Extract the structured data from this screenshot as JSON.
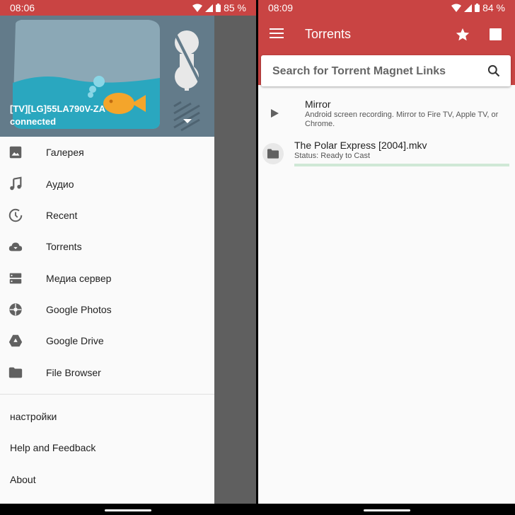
{
  "left": {
    "status_bar": {
      "time": "08:06",
      "battery": "85 %"
    },
    "device": {
      "name": "[TV][LG]55LA790V-ZA",
      "status": "connected"
    },
    "menu": [
      {
        "label": "Галерея",
        "icon": "gallery-icon"
      },
      {
        "label": "Аудио",
        "icon": "music-note-icon"
      },
      {
        "label": "Recent",
        "icon": "recent-icon"
      },
      {
        "label": "Torrents",
        "icon": "cloud-download-icon"
      },
      {
        "label": "Медиа сервер",
        "icon": "media-server-icon"
      },
      {
        "label": "Google Photos",
        "icon": "google-photos-icon"
      },
      {
        "label": "Google Drive",
        "icon": "google-drive-icon"
      },
      {
        "label": "File Browser",
        "icon": "folder-icon"
      }
    ],
    "secondary": [
      {
        "label": "настройки"
      },
      {
        "label": "Help and Feedback"
      },
      {
        "label": "About"
      }
    ]
  },
  "right": {
    "status_bar": {
      "time": "08:09",
      "battery": "84 %"
    },
    "appbar": {
      "title": "Torrents"
    },
    "search": {
      "placeholder": "Search for Torrent Magnet Links"
    },
    "items": [
      {
        "title": "Mirror",
        "subtitle": "Android screen recording. Mirror to Fire TV, Apple TV, or Chrome.",
        "icon": "play-icon"
      },
      {
        "title": "The Polar Express [2004].mkv",
        "subtitle": "Status: Ready to Cast",
        "icon": "folder-icon",
        "progress": 1.0
      }
    ]
  },
  "colors": {
    "accent": "#c94443",
    "header": "#637b8a",
    "tv": "#8ba8b6",
    "water": "#2aa7bf",
    "fish": "#f4a52b"
  }
}
